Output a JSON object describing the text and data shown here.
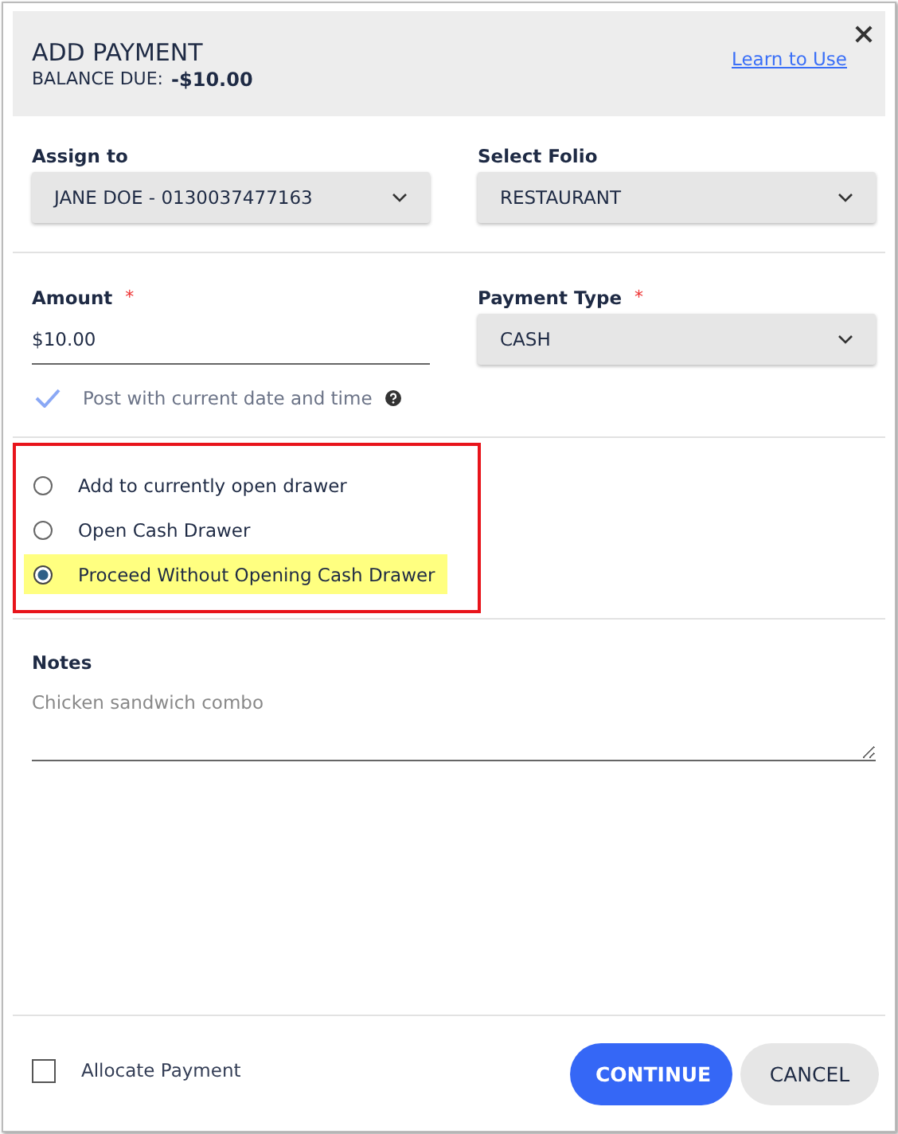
{
  "dialog": {
    "title": "ADD PAYMENT",
    "balance_label": "BALANCE DUE:",
    "balance_value": "-$10.00",
    "help_link": "Learn to Use"
  },
  "assign_to": {
    "label": "Assign to",
    "value": "JANE DOE - 0130037477163"
  },
  "folio": {
    "label": "Select Folio",
    "value": "RESTAURANT"
  },
  "amount": {
    "label": "Amount",
    "required_mark": "*",
    "value": "$10.00"
  },
  "payment_type": {
    "label": "Payment Type",
    "required_mark": "*",
    "value": "CASH"
  },
  "post_current": {
    "label": "Post with current date and time",
    "checked": true
  },
  "drawer_options": [
    {
      "label": "Add to currently open drawer",
      "selected": false,
      "highlighted": false
    },
    {
      "label": "Open Cash Drawer",
      "selected": false,
      "highlighted": false
    },
    {
      "label": "Proceed Without Opening Cash Drawer",
      "selected": true,
      "highlighted": true
    }
  ],
  "notes": {
    "label": "Notes",
    "placeholder": "Chicken sandwich combo"
  },
  "allocate_payment": {
    "label": "Allocate Payment",
    "checked": false
  },
  "buttons": [
    {
      "label": "CONTINUE",
      "kind": "primary"
    },
    {
      "label": "CANCEL",
      "kind": "secondary"
    }
  ]
}
